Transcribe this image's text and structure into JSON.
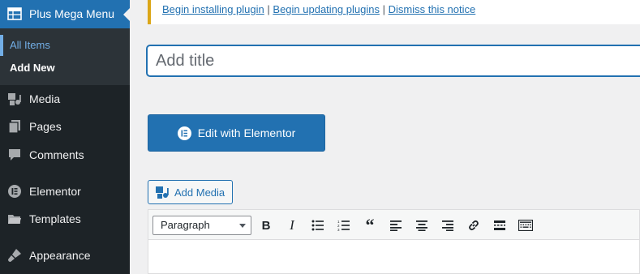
{
  "sidebar": {
    "current": {
      "label": "Plus Mega Menu",
      "icon": "table-icon"
    },
    "submenu": [
      {
        "label": "All Items"
      },
      {
        "label": "Add New"
      }
    ],
    "items": [
      {
        "label": "Media",
        "icon": "media-icon"
      },
      {
        "label": "Pages",
        "icon": "pages-icon"
      },
      {
        "label": "Comments",
        "icon": "comment-icon"
      },
      {
        "label": "Elementor",
        "icon": "elementor-icon"
      },
      {
        "label": "Templates",
        "icon": "folder-icon"
      },
      {
        "label": "Appearance",
        "icon": "brush-icon"
      }
    ]
  },
  "notice": {
    "links": [
      "Begin installing plugin",
      "Begin updating plugins",
      "Dismiss this notice"
    ],
    "separator": "|"
  },
  "editor": {
    "title_placeholder": "Add title",
    "elementor_button": "Edit with Elementor",
    "add_media": "Add Media",
    "format_select": "Paragraph",
    "toolbar_buttons": [
      "bold-icon",
      "italic-icon",
      "bullet-list-icon",
      "numbered-list-icon",
      "blockquote-icon",
      "align-left-icon",
      "align-center-icon",
      "align-right-icon",
      "link-icon",
      "read-more-icon",
      "toolbar-toggle-icon"
    ]
  },
  "colors": {
    "sidebar_bg": "#1d2327",
    "accent": "#2271b1",
    "notice_border": "#dba617"
  }
}
